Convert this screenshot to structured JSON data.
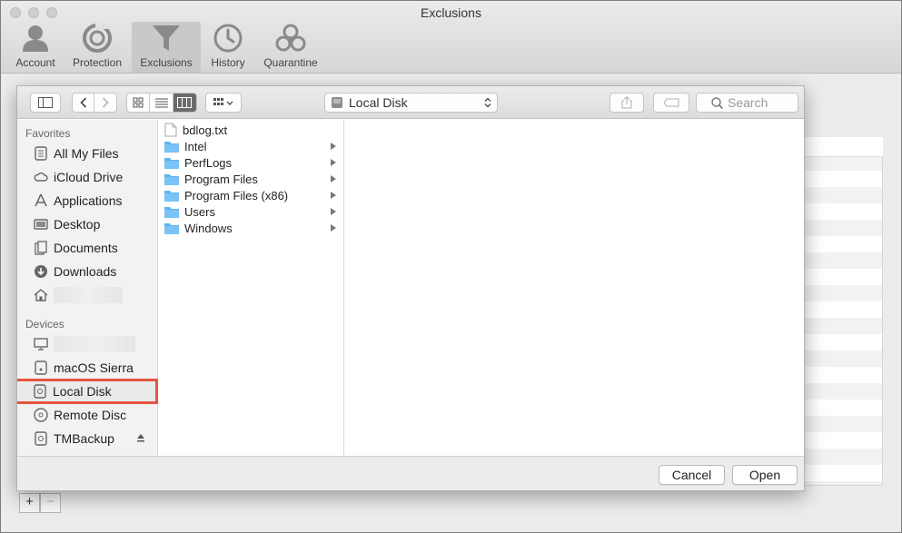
{
  "window": {
    "title": "Exclusions"
  },
  "toolbar": {
    "items": [
      {
        "label": "Account",
        "icon": "account-icon"
      },
      {
        "label": "Protection",
        "icon": "protection-icon"
      },
      {
        "label": "Exclusions",
        "icon": "funnel-icon",
        "active": true
      },
      {
        "label": "History",
        "icon": "clock-icon"
      },
      {
        "label": "Quarantine",
        "icon": "biohazard-icon"
      }
    ]
  },
  "dialog": {
    "location": "Local Disk",
    "search": {
      "placeholder": "Search",
      "value": ""
    },
    "sidebar": {
      "favorites_header": "Favorites",
      "favorites": [
        {
          "label": "All My Files",
          "icon": "all-files-icon"
        },
        {
          "label": "iCloud Drive",
          "icon": "cloud-icon"
        },
        {
          "label": "Applications",
          "icon": "applications-icon"
        },
        {
          "label": "Desktop",
          "icon": "desktop-icon"
        },
        {
          "label": "Documents",
          "icon": "documents-icon"
        },
        {
          "label": "Downloads",
          "icon": "downloads-icon"
        },
        {
          "label": "",
          "icon": "home-icon"
        }
      ],
      "devices_header": "Devices",
      "devices": [
        {
          "label": "",
          "icon": "computer-icon"
        },
        {
          "label": "macOS Sierra",
          "icon": "disk-icon"
        },
        {
          "label": "Local Disk",
          "icon": "disk-icon",
          "selected": true
        },
        {
          "label": "Remote Disc",
          "icon": "disc-icon"
        },
        {
          "label": "TMBackup",
          "icon": "disk-icon",
          "eject": true
        }
      ]
    },
    "files": [
      {
        "name": "bdlog.txt",
        "type": "file"
      },
      {
        "name": "Intel",
        "type": "folder"
      },
      {
        "name": "PerfLogs",
        "type": "folder"
      },
      {
        "name": "Program Files",
        "type": "folder"
      },
      {
        "name": "Program Files (x86)",
        "type": "folder"
      },
      {
        "name": "Users",
        "type": "folder"
      },
      {
        "name": "Windows",
        "type": "folder"
      }
    ],
    "buttons": {
      "cancel": "Cancel",
      "open": "Open"
    }
  },
  "footer": {
    "add": "+",
    "remove": "−"
  },
  "colors": {
    "highlight": "#e8553e",
    "folder": "#5fb3f0",
    "active_tab": "#c9c9c9"
  }
}
